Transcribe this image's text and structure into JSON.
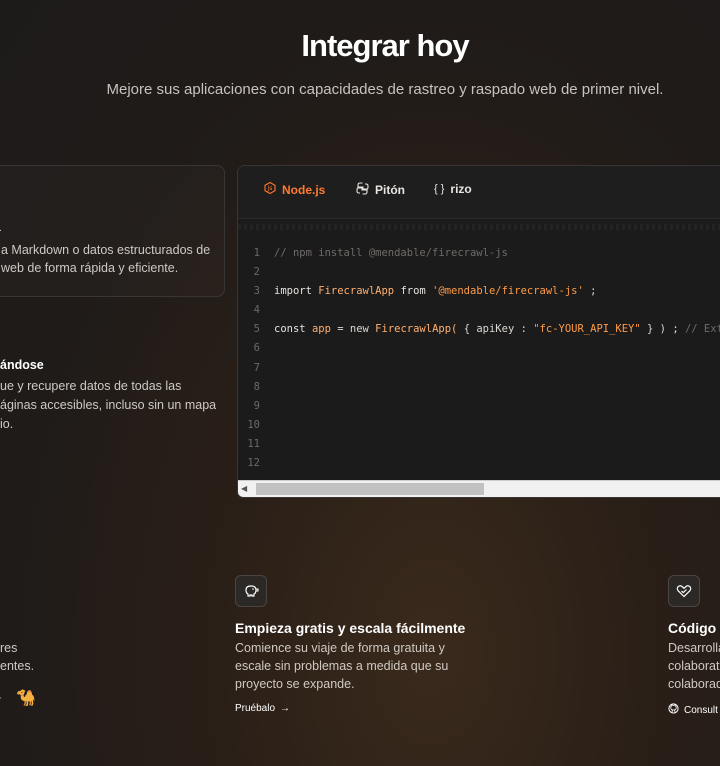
{
  "header": {
    "title": "Integrar hoy",
    "subtitle": "Mejore sus aplicaciones con capacidades de rastreo y raspado web de primer nivel."
  },
  "features": {
    "card_desc": "a Markdown o datos estructurados de\nweb de forma rápida y eficiente.",
    "item2_title": "ándose",
    "item2_desc": "ue y recupere datos de todas las\náginas accesibles, incluso sin un mapa\nio."
  },
  "editor": {
    "tabs": [
      {
        "label": "Node.js",
        "icon": "nodejs-icon",
        "active": true
      },
      {
        "label": "Pitón",
        "icon": "python-icon",
        "active": false
      },
      {
        "label": "rizo",
        "icon": "curl-braces-icon",
        "active": false
      }
    ],
    "line_numbers": [
      "1",
      "2",
      "3",
      "4",
      "5",
      "6",
      "7",
      "8",
      "9",
      "10",
      "11",
      "12"
    ],
    "code": {
      "line1_comment": "// npm install @mendable/firecrawl-js",
      "line3_import": "import",
      "line3_name": "FirecrawlApp",
      "line3_from": "from",
      "line3_module": "'@mendable/firecrawl-js'",
      "line3_semi": ";",
      "line5_const": "const",
      "line5_var": "app",
      "line5_eq": "= new",
      "line5_cls": "FirecrawlApp(",
      "line5_obj_open": "{ apiKey :",
      "line5_key": "\"fc-YOUR_API_KEY\"",
      "line5_obj_close": "} ) ;",
      "line5_comment": "// Extra"
    }
  },
  "cards": [
    {
      "icon": "piggy-bank-icon",
      "title": "Empieza gratis y escala fácilmente",
      "desc": "Comience su viaje de forma gratuita y escale sin problemas a medida que su proyecto se expande.",
      "link": "Pruébalo"
    },
    {
      "icon": "heart-icon",
      "title": "Código a",
      "desc": "Desarrolla\ncolaborati\ncolaborad",
      "link": "Consult"
    }
  ],
  "left_card": {
    "desc": "res\nentes."
  },
  "colors": {
    "accent": "#ff7a2f",
    "background": "#1f1b19"
  }
}
